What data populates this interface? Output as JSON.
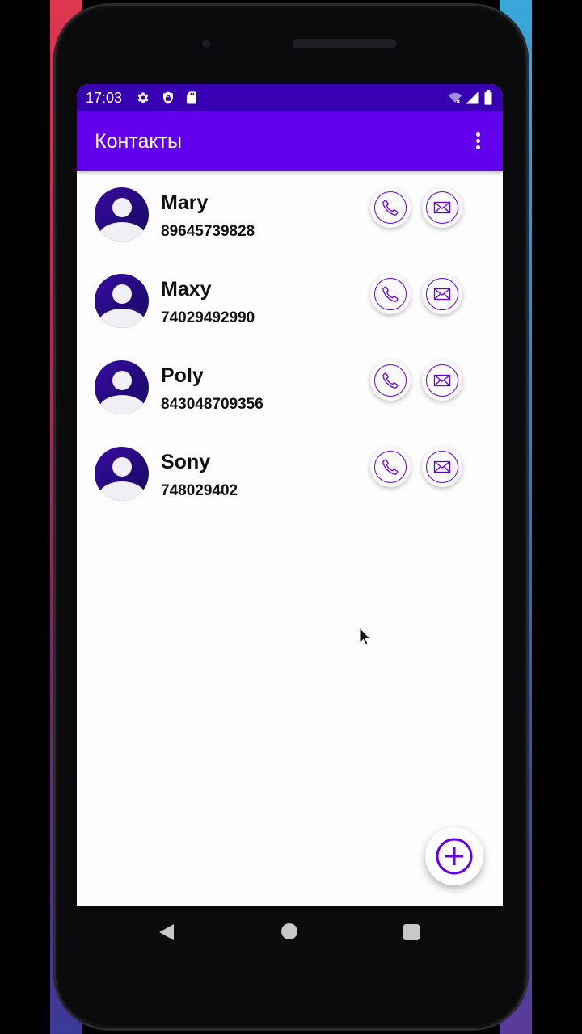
{
  "status_bar": {
    "time": "17:03",
    "left_icons": [
      "settings-icon",
      "shield-icon",
      "sd-card-icon"
    ],
    "right_icons": [
      "wifi-icon",
      "signal-icon",
      "battery-icon"
    ]
  },
  "app_bar": {
    "title": "Контакты",
    "menu_icon": "more-vert-icon"
  },
  "contacts": [
    {
      "name": "Mary",
      "phone": "89645739828"
    },
    {
      "name": "Maxy",
      "phone": "74029492990"
    },
    {
      "name": "Poly",
      "phone": "843048709356"
    },
    {
      "name": "Sony",
      "phone": "748029402"
    }
  ],
  "row_actions": [
    "call-icon",
    "mail-icon"
  ],
  "fab": {
    "icon": "add-circle-icon"
  },
  "colors": {
    "status_bar": "#3700b3",
    "primary": "#6200ee",
    "avatar": "#240a7a",
    "background": "#fdfdfd"
  },
  "nav_bar": {
    "buttons": [
      "back",
      "home",
      "recents"
    ]
  }
}
